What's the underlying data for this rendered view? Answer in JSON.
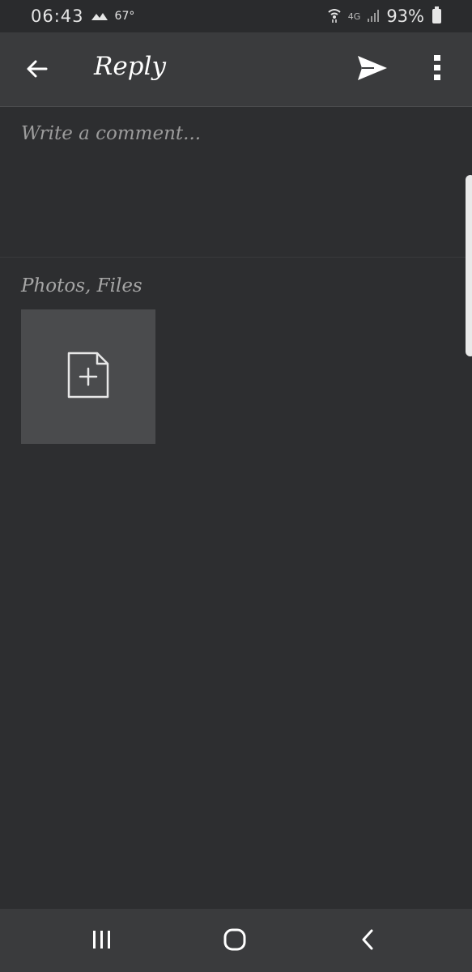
{
  "status_bar": {
    "time": "06:43",
    "temperature": "67°",
    "network": "4G",
    "battery": "93%"
  },
  "app_bar": {
    "title": "Reply",
    "icons": [
      "back-arrow-icon",
      "send-icon",
      "more-vert-icon"
    ]
  },
  "comment": {
    "placeholder": "Write a comment...",
    "value": ""
  },
  "attachments": {
    "label": "Photos, Files",
    "add_icon": "add-file-icon"
  },
  "nav_bar": {
    "icons": [
      "recents-icon",
      "home-icon",
      "back-icon"
    ]
  },
  "colors": {
    "background": "#2d2e30",
    "app_bar": "#3a3b3d",
    "tile": "#4a4b4d"
  }
}
